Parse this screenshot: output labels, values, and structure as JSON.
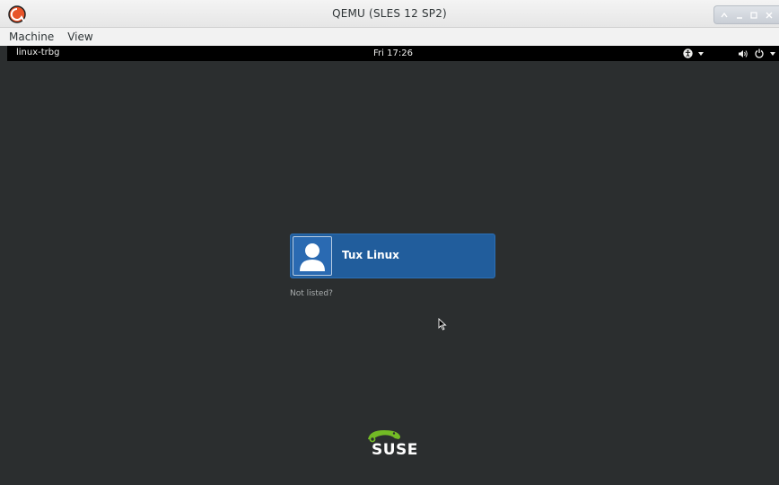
{
  "window": {
    "title": "QEMU (SLES 12 SP2)",
    "app_icon": "qemu-icon"
  },
  "window_controls": {
    "icons": [
      "up-arrow-icon",
      "minimize-icon",
      "maximize-icon",
      "close-icon"
    ]
  },
  "menubar": {
    "items": [
      "Machine",
      "View"
    ]
  },
  "guest": {
    "topbar": {
      "hostname": "linux-trbg",
      "clock": "Fri 17:26",
      "a11y_icon": "accessibility-icon",
      "volume_icon": "volume-icon",
      "power_icon": "power-icon"
    },
    "login": {
      "user_name": "Tux Linux",
      "avatar_icon": "user-avatar-icon",
      "not_listed_label": "Not listed?"
    },
    "branding": {
      "wordmark": "SUSE",
      "logo_icon": "suse-chameleon-icon"
    }
  },
  "colors": {
    "background": "#2b2e2f",
    "topbar": "#000000",
    "user_button": "#215d9c",
    "suse_green": "#73ba25"
  }
}
